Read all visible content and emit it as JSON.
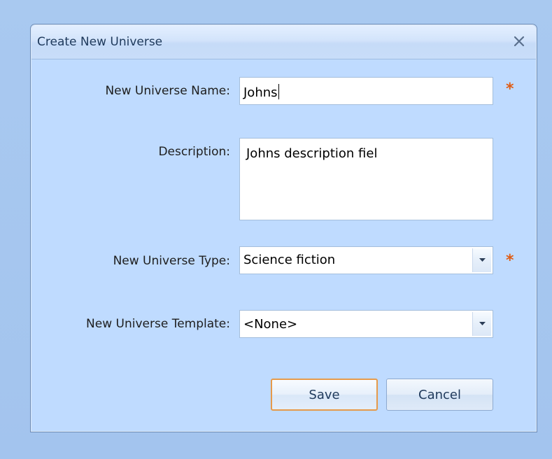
{
  "dialog": {
    "title": "Create New Universe",
    "close_icon": "close-icon"
  },
  "form": {
    "name_label": "New Universe Name:",
    "name_value": "Johns",
    "description_label": "Description:",
    "description_value": "Johns description fiel",
    "type_label": "New Universe Type:",
    "type_value": "Science fiction",
    "template_label": "New Universe Template:",
    "template_value": "<None>",
    "required_marker": "*"
  },
  "buttons": {
    "save_label": "Save",
    "cancel_label": "Cancel"
  },
  "colors": {
    "background": "#a9c9f0",
    "dialog_body": "#bfdbff",
    "required": "#e05c14",
    "default_button_border": "#e69a4a"
  }
}
